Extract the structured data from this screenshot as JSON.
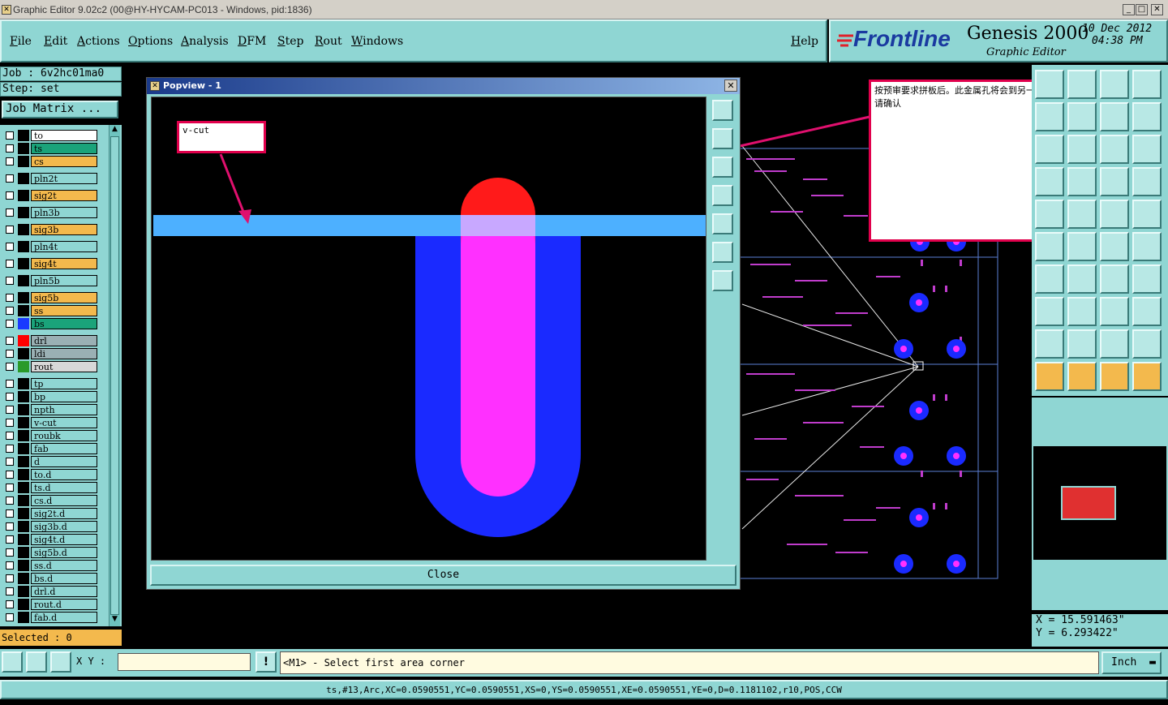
{
  "window": {
    "title": "Graphic Editor 9.02c2 (00@HY-HYCAM-PC013 - Windows, pid:1836)",
    "minimize": "_",
    "maximize": "□",
    "close": "✕"
  },
  "menu": {
    "items": [
      "File",
      "Edit",
      "Actions",
      "Options",
      "Analysis",
      "DFM",
      "Step",
      "Rout",
      "Windows"
    ],
    "help": "Help"
  },
  "brand": {
    "logo": "Frontline",
    "product": "Genesis 2000",
    "module": "Graphic Editor",
    "date": "10 Dec 2012",
    "time": "04:38 PM"
  },
  "left": {
    "job": "Job : 6v2hc01ma0",
    "step": "Step: set",
    "job_matrix": "Job Matrix ...",
    "selected": "Selected : 0",
    "layers": [
      {
        "name": "to",
        "color": "#ffffff",
        "swatch": "#000000"
      },
      {
        "name": "ts",
        "color": "#1aa37a",
        "swatch": "#000000"
      },
      {
        "name": "cs",
        "color": "#f3b94d",
        "swatch": "#000000"
      },
      {
        "name": "pln2t",
        "color": "#8fd6d3",
        "swatch": "#000000"
      },
      {
        "name": "sig2t",
        "color": "#f3b94d",
        "swatch": "#000000"
      },
      {
        "name": "pln3b",
        "color": "#8fd6d3",
        "swatch": "#000000"
      },
      {
        "name": "sig3b",
        "color": "#f3b94d",
        "swatch": "#000000"
      },
      {
        "name": "pln4t",
        "color": "#8fd6d3",
        "swatch": "#000000"
      },
      {
        "name": "sig4t",
        "color": "#f3b94d",
        "swatch": "#000000"
      },
      {
        "name": "pln5b",
        "color": "#8fd6d3",
        "swatch": "#000000"
      },
      {
        "name": "sig5b",
        "color": "#f3b94d",
        "swatch": "#000000"
      },
      {
        "name": "ss",
        "color": "#f3b94d",
        "swatch": "#000000"
      },
      {
        "name": "bs",
        "color": "#1aa37a",
        "swatch": "#1a3aff"
      },
      {
        "name": "drl",
        "color": "#9ab0b4",
        "swatch": "#ff0000"
      },
      {
        "name": "ldi",
        "color": "#9ab0b4",
        "swatch": "#000000"
      },
      {
        "name": "rout",
        "color": "#d8d8d8",
        "swatch": "#2a9a2a"
      },
      {
        "name": "tp",
        "color": "#8fd6d3",
        "swatch": "#000000"
      },
      {
        "name": "bp",
        "color": "#8fd6d3",
        "swatch": "#000000"
      },
      {
        "name": "npth",
        "color": "#8fd6d3",
        "swatch": "#000000"
      },
      {
        "name": "v-cut",
        "color": "#8fd6d3",
        "swatch": "#000000"
      },
      {
        "name": "roubk",
        "color": "#8fd6d3",
        "swatch": "#000000"
      },
      {
        "name": "fab",
        "color": "#8fd6d3",
        "swatch": "#000000"
      },
      {
        "name": "d",
        "color": "#8fd6d3",
        "swatch": "#000000"
      },
      {
        "name": "to.d",
        "color": "#8fd6d3",
        "swatch": "#000000"
      },
      {
        "name": "ts.d",
        "color": "#8fd6d3",
        "swatch": "#000000"
      },
      {
        "name": "cs.d",
        "color": "#8fd6d3",
        "swatch": "#000000"
      },
      {
        "name": "sig2t.d",
        "color": "#8fd6d3",
        "swatch": "#000000"
      },
      {
        "name": "sig3b.d",
        "color": "#8fd6d3",
        "swatch": "#000000"
      },
      {
        "name": "sig4t.d",
        "color": "#8fd6d3",
        "swatch": "#000000"
      },
      {
        "name": "sig5b.d",
        "color": "#8fd6d3",
        "swatch": "#000000"
      },
      {
        "name": "ss.d",
        "color": "#8fd6d3",
        "swatch": "#000000"
      },
      {
        "name": "bs.d",
        "color": "#8fd6d3",
        "swatch": "#000000"
      },
      {
        "name": "drl.d",
        "color": "#8fd6d3",
        "swatch": "#000000"
      },
      {
        "name": "rout.d",
        "color": "#8fd6d3",
        "swatch": "#000000"
      },
      {
        "name": "fab.d",
        "color": "#8fd6d3",
        "swatch": "#000000"
      }
    ]
  },
  "popview": {
    "title": "Popview - 1",
    "close_label": "Close",
    "vcut_note": "v-cut"
  },
  "annotation": {
    "text": "按预审要求拼板后。此金属孔将会到另一板里面去，请确认"
  },
  "coords": {
    "x": "X  =  15.591463\"",
    "y": "Y  =  6.293422\""
  },
  "bottom": {
    "xy_label": "X Y :",
    "xy_value": "",
    "prompt": "<M1> - Select first area corner",
    "unit": "Inch",
    "status": "ts,#13,Arc,XC=0.0590551,YC=0.0590551,XS=0,YS=0.0590551,XE=0.0590551,YE=0,D=0.1181102,r10,POS,CCW"
  }
}
